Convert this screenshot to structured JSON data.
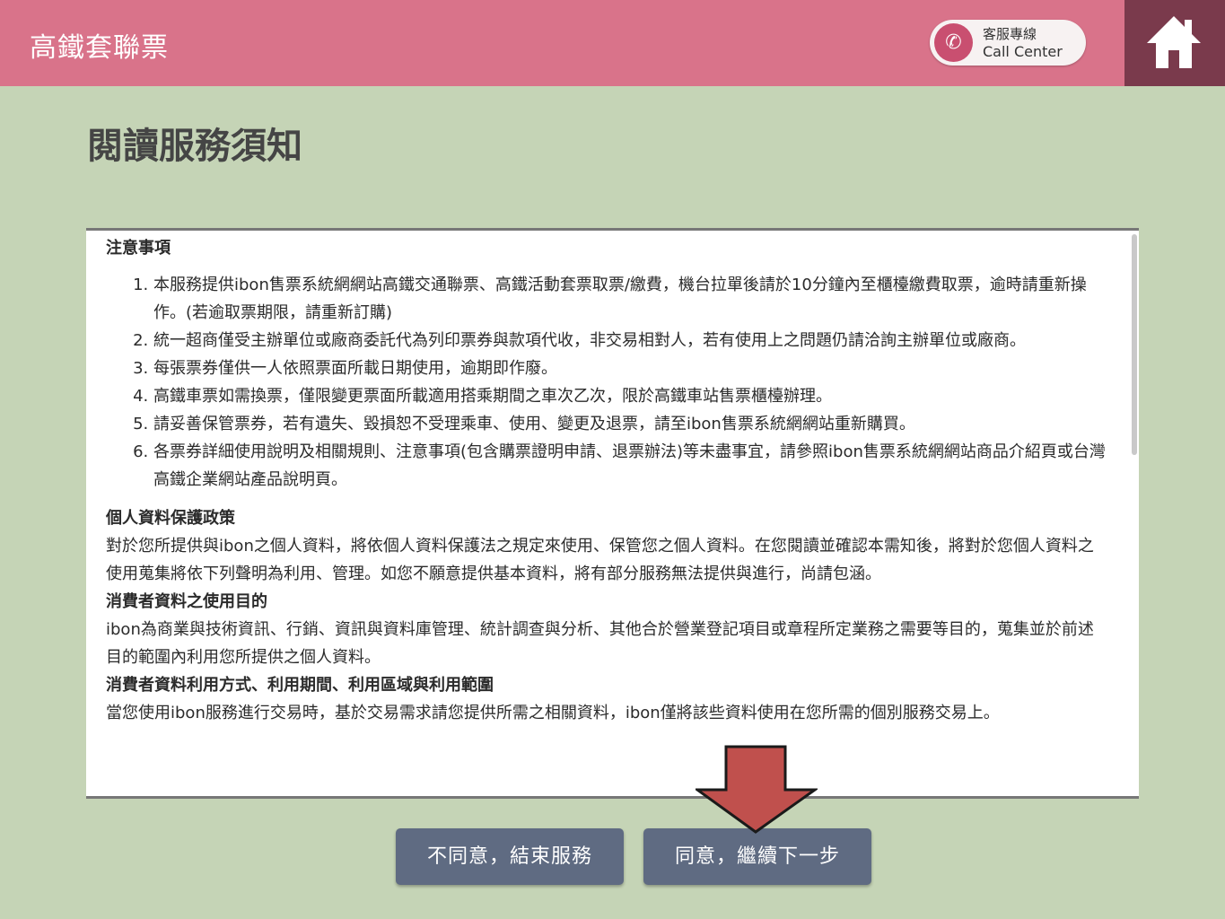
{
  "header": {
    "title": "高鐵套聯票",
    "call_center_cn": "客服專線",
    "call_center_en": "Call Center",
    "phone_icon": "phone-icon",
    "home_icon": "home-icon",
    "bar_color": "#d9738a",
    "home_color": "#7a3a4c"
  },
  "page": {
    "title": "閱讀服務須知",
    "background": "#c5d4b6"
  },
  "notice": {
    "section1_title": "注意事項",
    "items": [
      "本服務提供ibon售票系統網網站高鐵交通聯票、高鐵活動套票取票/繳費，機台拉單後請於10分鐘內至櫃檯繳費取票，逾時請重新操作。(若逾取票期限，請重新訂購)",
      "統一超商僅受主辦單位或廠商委託代為列印票券與款項代收，非交易相對人，若有使用上之問題仍請洽詢主辦單位或廠商。",
      "每張票券僅供一人依照票面所載日期使用，逾期即作廢。",
      "高鐵車票如需換票，僅限變更票面所載適用搭乘期間之車次乙次，限於高鐵車站售票櫃檯辦理。",
      "請妥善保管票券，若有遺失、毀損恕不受理乘車、使用、變更及退票，請至ibon售票系統網網站重新購買。",
      "各票券詳細使用說明及相關規則、注意事項(包含購票證明申請、退票辦法)等未盡事宜，請參照ibon售票系統網網站商品介紹頁或台灣高鐵企業網站產品說明頁。"
    ],
    "section2_title": "個人資料保護政策",
    "section2_text": "對於您所提供與ibon之個人資料，將依個人資料保護法之規定來使用、保管您之個人資料。在您閱讀並確認本需知後，將對於您個人資料之使用蒐集將依下列聲明為利用、管理。如您不願意提供基本資料，將有部分服務無法提供與進行，尚請包涵。",
    "section3_title": "消費者資料之使用目的",
    "section3_text": "ibon為商業與技術資訊、行銷、資訊與資料庫管理、統計調查與分析、其他合於營業登記項目或章程所定業務之需要等目的，蒐集並於前述目的範圍內利用您所提供之個人資料。",
    "section4_title": "消費者資料利用方式、利用期間、利用區域與利用範圍",
    "section4_text": "當您使用ibon服務進行交易時，基於交易需求請您提供所需之相關資料，ibon僅將該些資料使用在您所需的個別服務交易上。"
  },
  "buttons": {
    "decline": "不同意，結束服務",
    "agree": "同意，繼續下一步",
    "color": "#5f6b82"
  },
  "annotation": {
    "arrow_icon": "arrow-down-icon",
    "arrow_color": "#c0504d"
  }
}
